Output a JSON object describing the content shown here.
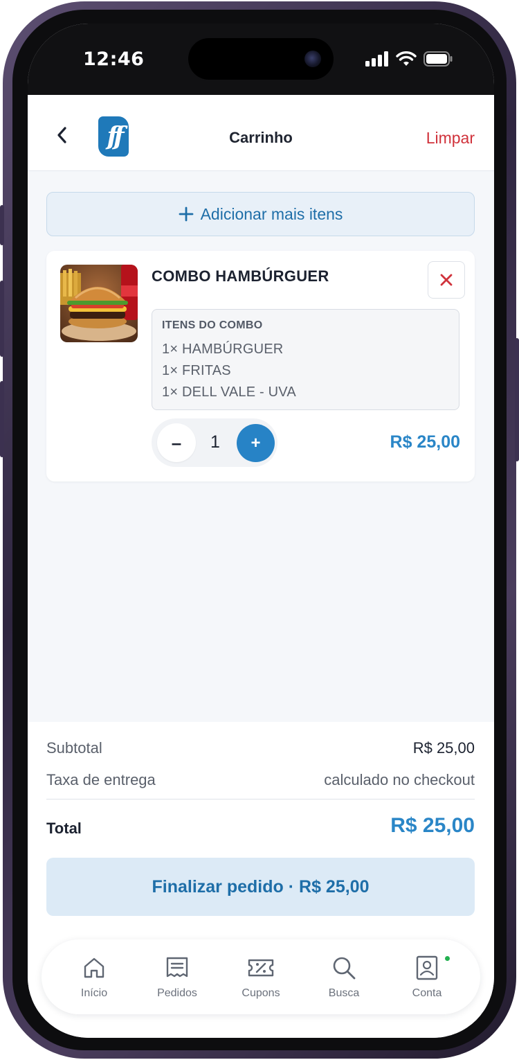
{
  "status_bar": {
    "time": "12:46"
  },
  "header": {
    "title": "Carrinho",
    "clear_label": "Limpar",
    "logo_text": "ff"
  },
  "add_more": {
    "label": "Adicionar mais itens"
  },
  "cart_item": {
    "name": "COMBO HAMBÚRGUER",
    "combo_title": "ITENS DO COMBO",
    "combo_items": [
      "1× HAMBÚRGUER",
      "1× FRITAS",
      "1× DELL VALE - UVA"
    ],
    "quantity": "1",
    "minus_label": "–",
    "plus_label": "+",
    "price": "R$ 25,00"
  },
  "summary": {
    "subtotal_label": "Subtotal",
    "subtotal_value": "R$ 25,00",
    "fee_label": "Taxa de entrega",
    "fee_value": "calculado no checkout",
    "total_label": "Total",
    "total_value": "R$ 25,00",
    "checkout_label": "Finalizar pedido · R$ 25,00"
  },
  "nav": {
    "items": [
      {
        "label": "Início",
        "icon": "home-icon"
      },
      {
        "label": "Pedidos",
        "icon": "receipt-icon"
      },
      {
        "label": "Cupons",
        "icon": "coupon-icon"
      },
      {
        "label": "Busca",
        "icon": "search-icon"
      },
      {
        "label": "Conta",
        "icon": "account-icon"
      }
    ]
  },
  "colors": {
    "accent": "#2a86c7",
    "danger": "#d0323b",
    "notification_dot": "#23b050"
  }
}
